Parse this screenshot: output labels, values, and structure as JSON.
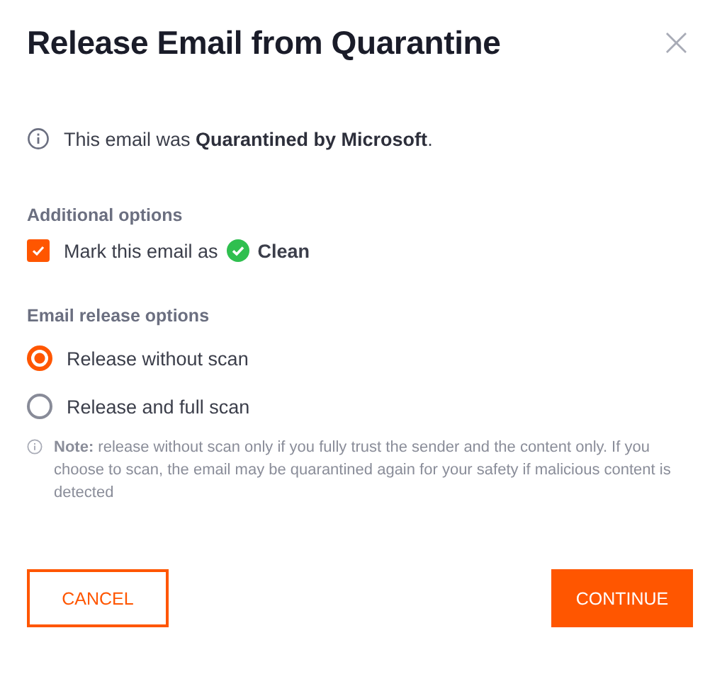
{
  "dialog": {
    "title": "Release Email from Quarantine",
    "close": "×"
  },
  "info": "This email was **Quarantined by Microsoft**.",
  "additional_options": {
    "heading": "Additional options",
    "checkbox": {
      "label": "Mark this email as",
      "status": "Clean",
      "checked": true
    }
  },
  "release_options": {
    "heading": "Email release options",
    "radios": [
      {
        "label": "Release without scan",
        "selected": true
      },
      {
        "label": "Release and full scan",
        "selected": false
      }
    ]
  },
  "note": "**Note:** release without scan only if you fully trust the sender and the content only. If you choose to scan, the email may be quarantined again for your safety if malicious content is detected",
  "buttons": [
    {
      "label": "CANCEL",
      "kind": "secondary"
    },
    {
      "label": "CONTINUE",
      "kind": "primary"
    }
  ]
}
